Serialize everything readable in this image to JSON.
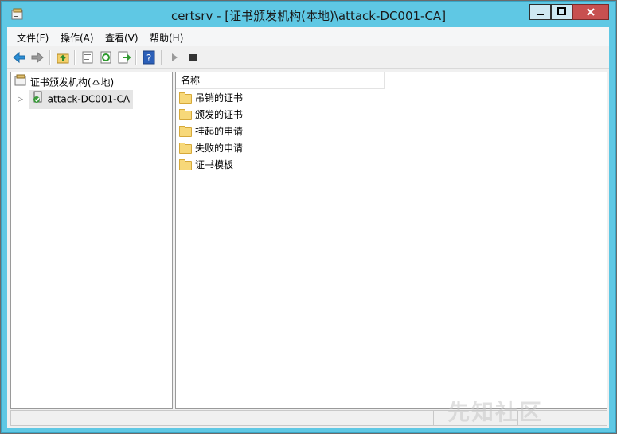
{
  "window": {
    "title": "certsrv - [证书颁发机构(本地)\\attack-DC001-CA]",
    "accent_color": "#5fc8e4",
    "close_color": "#c75050"
  },
  "menu": {
    "items": [
      {
        "label": "文件(F)"
      },
      {
        "label": "操作(A)"
      },
      {
        "label": "查看(V)"
      },
      {
        "label": "帮助(H)"
      }
    ]
  },
  "toolbar": {
    "icons": [
      "back-arrow-icon",
      "forward-arrow-icon",
      "up-folder-icon",
      "properties-icon",
      "refresh-icon",
      "export-list-icon",
      "help-icon",
      "start-service-icon",
      "stop-service-icon"
    ]
  },
  "tree": {
    "root_label": "证书颁发机构(本地)",
    "child_label": "attack-DC001-CA"
  },
  "list": {
    "column_header": "名称",
    "items": [
      {
        "label": "吊销的证书"
      },
      {
        "label": "颁发的证书"
      },
      {
        "label": "挂起的申请"
      },
      {
        "label": "失败的申请"
      },
      {
        "label": "证书模板"
      }
    ]
  },
  "watermark": {
    "text": "先知社区"
  }
}
